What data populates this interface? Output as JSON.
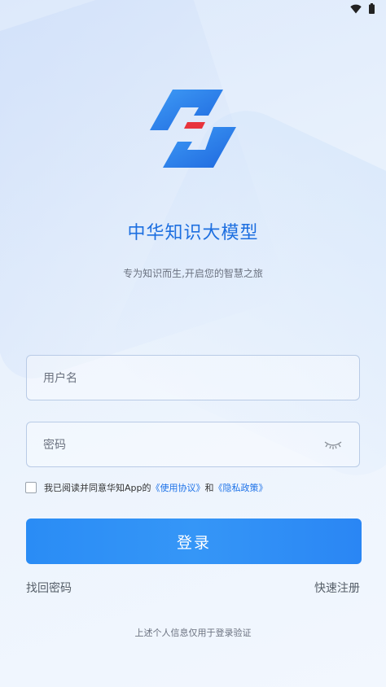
{
  "status_bar": {
    "wifi_icon": "wifi-icon",
    "battery_icon": "battery-icon"
  },
  "brand": {
    "title": "中华知识大模型",
    "slogan": "专为知识而生,开启您的智慧之旅",
    "accent_color": "#1d6fe0",
    "logo_colors": {
      "blue": "#2a7de9",
      "red": "#e8343c"
    }
  },
  "form": {
    "username": {
      "value": "",
      "placeholder": "用户名"
    },
    "password": {
      "value": "",
      "placeholder": "密码",
      "toggle_icon": "eye-closed-icon"
    }
  },
  "agreement": {
    "checked": false,
    "prefix": "我已阅读并同意华知App的",
    "terms_link": "《使用协议》",
    "conjunction": "和",
    "privacy_link": "《隐私政策》"
  },
  "actions": {
    "login_label": "登录",
    "forgot_password_label": "找回密码",
    "register_label": "快速注册"
  },
  "footer": {
    "note": "上述个人信息仅用于登录验证"
  }
}
